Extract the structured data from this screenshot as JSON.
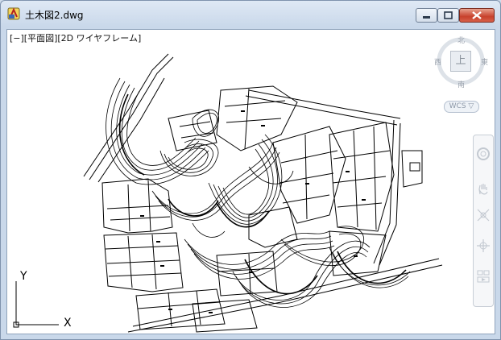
{
  "window": {
    "title": "土木図2.dwg",
    "icon": "autocad-dwg-icon",
    "buttons": [
      "minimize-icon",
      "maximize-icon",
      "close-icon"
    ]
  },
  "viewport": {
    "label": "[−][平面図][2D ワイヤフレーム]"
  },
  "viewcube": {
    "north": "北",
    "south": "南",
    "east": "東",
    "west": "西",
    "face": "上"
  },
  "wcs": {
    "label": "WCS ▽"
  },
  "navbar": {
    "tools": [
      "steering-wheel-icon",
      "pan-hand-icon",
      "zoom-extents-icon",
      "orbit-icon",
      "showmotion-icon"
    ]
  },
  "ucs_icon": {
    "x_label": "X",
    "y_label": "Y"
  }
}
